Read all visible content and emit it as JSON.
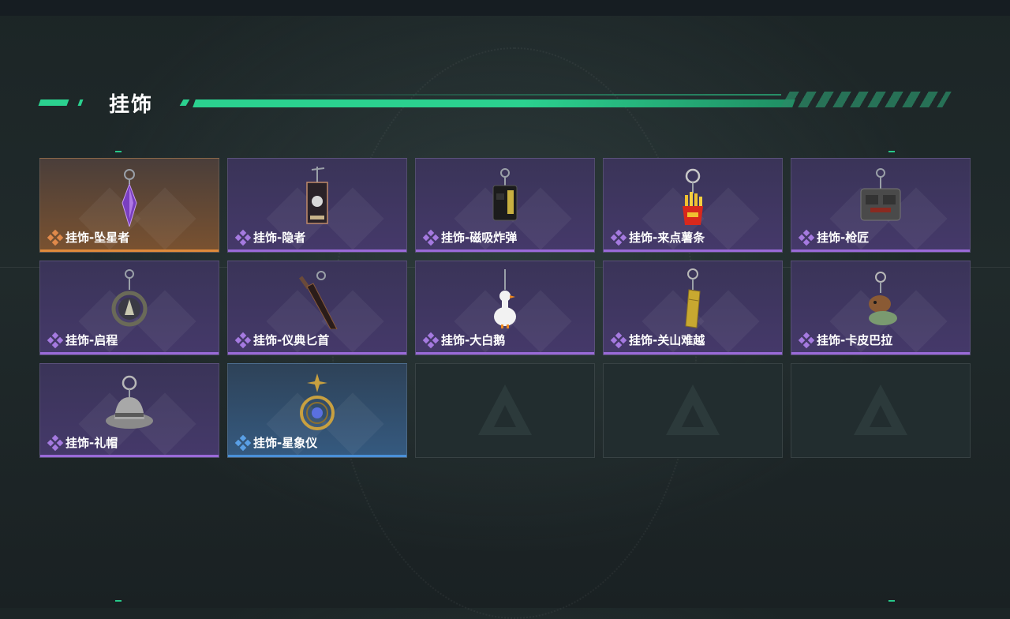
{
  "section": {
    "title": "挂饰"
  },
  "colors": {
    "accent": "#2bd18f",
    "purple_rarity": "#9a6ad8",
    "orange_rarity": "#e08a3c",
    "blue_rarity": "#4a90d8"
  },
  "items": [
    {
      "label": "挂饰-坠星者",
      "rarity": "orange",
      "icon": "purple-crystal-pendant-icon"
    },
    {
      "label": "挂饰-隐者",
      "rarity": "purple",
      "icon": "tarot-card-pendant-icon"
    },
    {
      "label": "挂饰-磁吸炸弹",
      "rarity": "purple",
      "icon": "magnetic-bomb-pendant-icon"
    },
    {
      "label": "挂饰-来点薯条",
      "rarity": "purple",
      "icon": "french-fries-pendant-icon"
    },
    {
      "label": "挂饰-枪匠",
      "rarity": "purple",
      "icon": "gunsmith-vest-pendant-icon"
    },
    {
      "label": "挂饰-启程",
      "rarity": "purple",
      "icon": "compass-ring-pendant-icon"
    },
    {
      "label": "挂饰-仪典匕首",
      "rarity": "purple",
      "icon": "ceremonial-dagger-pendant-icon"
    },
    {
      "label": "挂饰-大白鹅",
      "rarity": "purple",
      "icon": "white-goose-pendant-icon"
    },
    {
      "label": "挂饰-关山难越",
      "rarity": "purple",
      "icon": "gold-bar-pendant-icon"
    },
    {
      "label": "挂饰-卡皮巴拉",
      "rarity": "purple",
      "icon": "capybara-pendant-icon"
    },
    {
      "label": "挂饰-礼帽",
      "rarity": "purple",
      "icon": "fedora-hat-pendant-icon"
    },
    {
      "label": "挂饰-星象仪",
      "rarity": "blue",
      "icon": "astrolabe-pendant-icon"
    }
  ],
  "empty_slots": 3
}
